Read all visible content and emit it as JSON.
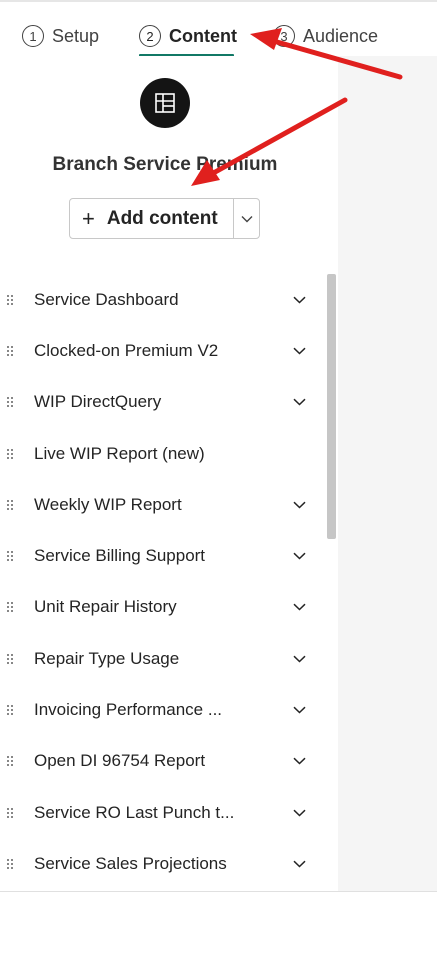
{
  "steps": [
    {
      "number": "1",
      "label": "Setup",
      "active": false
    },
    {
      "number": "2",
      "label": "Content",
      "active": true
    },
    {
      "number": "3",
      "label": "Audience",
      "active": false
    }
  ],
  "app": {
    "title": "Branch Service Premium",
    "icon": "app-layout-icon"
  },
  "add_content": {
    "label": "Add content",
    "plus": "+"
  },
  "items": [
    {
      "label": "Service Dashboard",
      "expandable": true
    },
    {
      "label": "Clocked-on Premium V2",
      "expandable": true
    },
    {
      "label": "WIP DirectQuery",
      "expandable": true
    },
    {
      "label": "Live WIP Report (new)",
      "expandable": false
    },
    {
      "label": "Weekly WIP Report",
      "expandable": true
    },
    {
      "label": "Service Billing Support",
      "expandable": true
    },
    {
      "label": "Unit Repair History",
      "expandable": true
    },
    {
      "label": "Repair Type Usage",
      "expandable": true
    },
    {
      "label": "Invoicing Performance ...",
      "expandable": true
    },
    {
      "label": "Open DI 96754 Report",
      "expandable": true
    },
    {
      "label": "Service RO Last Punch t...",
      "expandable": true
    },
    {
      "label": "Service Sales Projections",
      "expandable": true
    }
  ],
  "colors": {
    "accent": "#117865",
    "annotation_arrow": "#e0201e"
  }
}
